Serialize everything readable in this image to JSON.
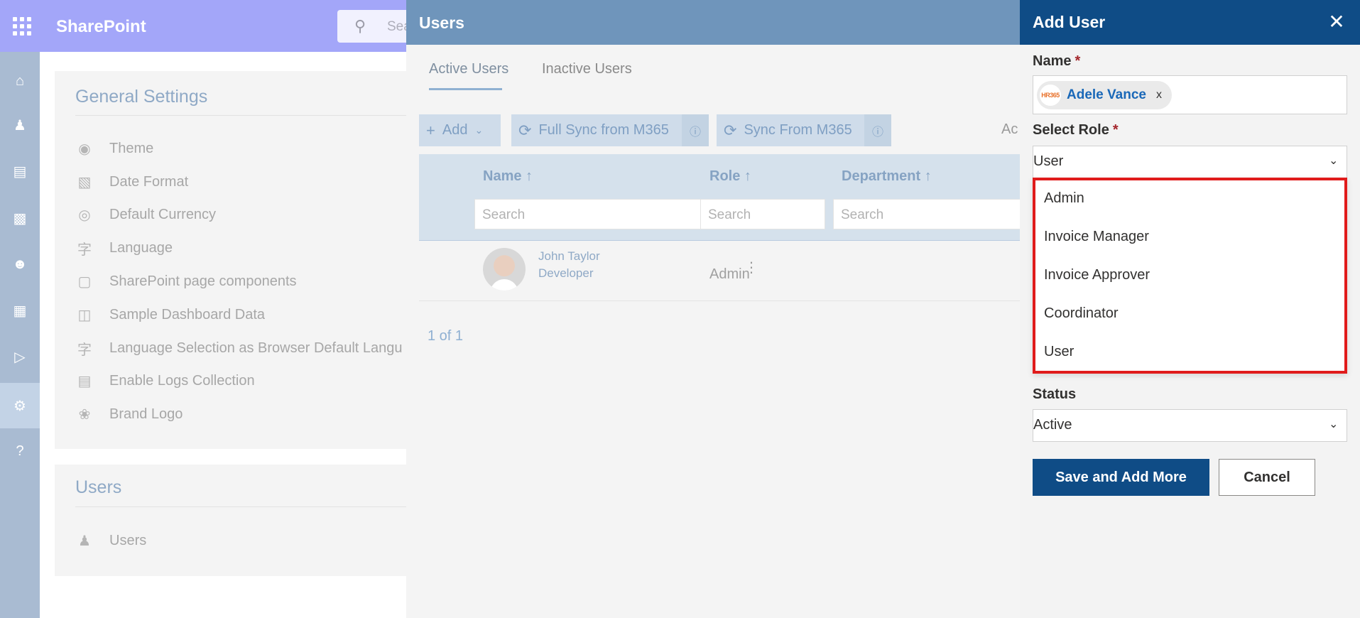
{
  "app": {
    "name": "SharePoint",
    "search_placeholder": "Search"
  },
  "rail": [
    "home-icon",
    "people-icon",
    "chart-icon",
    "bar-chart-icon",
    "user-settings-icon",
    "document-icon",
    "play-icon",
    "gear-icon",
    "help-icon"
  ],
  "settings": {
    "title": "General Settings",
    "items": [
      {
        "label": "Theme",
        "icon": "palette-icon"
      },
      {
        "label": "Date Format",
        "icon": "calendar-icon"
      },
      {
        "label": "Default Currency",
        "icon": "currency-icon"
      },
      {
        "label": "Language",
        "icon": "language-icon"
      },
      {
        "label": "SharePoint page components",
        "icon": "page-icon"
      },
      {
        "label": "Sample Dashboard Data",
        "icon": "dashboard-icon"
      },
      {
        "label": "Language Selection as Browser Default Langu",
        "icon": "language-icon"
      },
      {
        "label": "Enable Logs Collection",
        "icon": "logs-icon"
      },
      {
        "label": "Brand Logo",
        "icon": "badge-icon"
      }
    ]
  },
  "users_section": {
    "title": "Users",
    "item": "Users"
  },
  "users_panel": {
    "title": "Users",
    "tabs": [
      "Active Users",
      "Inactive Users"
    ],
    "toolbar": {
      "add": "Add",
      "full_sync": "Full Sync from M365",
      "sync": "Sync From M365",
      "more": "Ac"
    },
    "columns": [
      "Name ↑",
      "Role ↑",
      "Department ↑"
    ],
    "search_placeholder": "Search",
    "rows": [
      {
        "name": "John Taylor",
        "job": "Developer",
        "role": "Admin"
      }
    ],
    "pager": "1 of 1"
  },
  "add_user": {
    "title": "Add User",
    "name_label": "Name",
    "selected_person": "Adele Vance",
    "selected_person_logo": "HR365",
    "chip_remove": "x",
    "role_label": "Select Role",
    "role_value": "User",
    "role_options": [
      "Admin",
      "Invoice Manager",
      "Invoice Approver",
      "Coordinator",
      "User"
    ],
    "status_label": "Status",
    "status_value": "Active",
    "save_more": "Save and Add More",
    "cancel": "Cancel"
  },
  "colors": {
    "header_dark": "#0f4c86",
    "users_header": "#6f95bb",
    "topbar": "#a3a6f9",
    "highlight": "#e01b1b"
  }
}
